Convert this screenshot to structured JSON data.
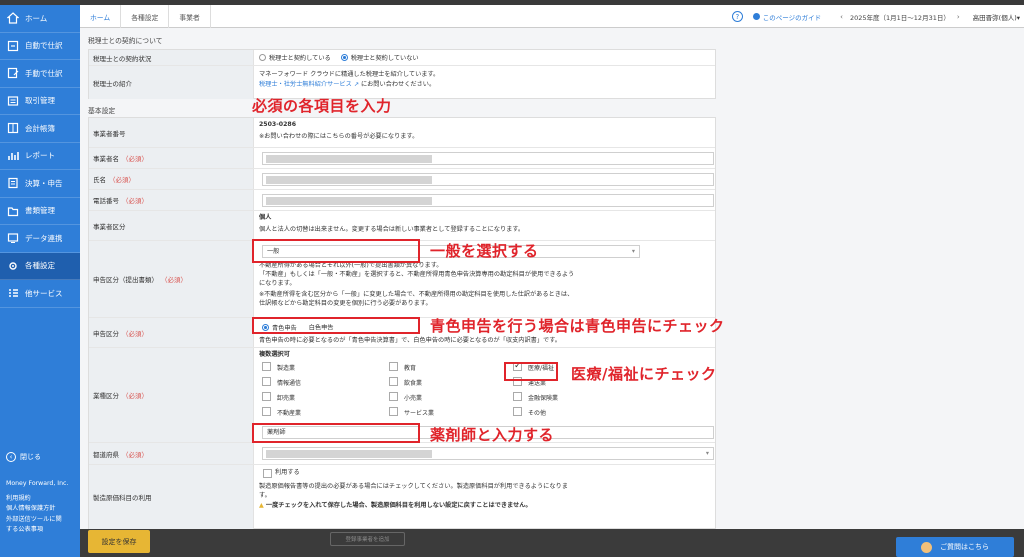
{
  "sidebar": {
    "items": [
      {
        "label": "ホーム",
        "icon": "home-icon"
      },
      {
        "label": "自動で仕訳",
        "icon": "auto-journal-icon"
      },
      {
        "label": "手動で仕訳",
        "icon": "manual-journal-icon"
      },
      {
        "label": "取引管理",
        "icon": "transaction-icon"
      },
      {
        "label": "会計帳簿",
        "icon": "ledger-icon"
      },
      {
        "label": "レポート",
        "icon": "report-icon"
      },
      {
        "label": "決算・申告",
        "icon": "tax-return-icon"
      },
      {
        "label": "書類管理",
        "icon": "folder-icon"
      },
      {
        "label": "データ連携",
        "icon": "data-link-icon"
      },
      {
        "label": "各種設定",
        "icon": "gear-icon"
      },
      {
        "label": "他サービス",
        "icon": "grid-icon"
      }
    ],
    "close_label": "閉じる",
    "company": "Money Forward, Inc.",
    "links": [
      "利用規約",
      "個人情報保護方針",
      "外部送信ツールに関",
      "する公表事項"
    ]
  },
  "header": {
    "breadcrumb": [
      "ホーム",
      "各種設定",
      "事業者"
    ],
    "help": "?",
    "guide_label": "このページのガイド",
    "fiscal_year": "2025年度（1月1日〜12月31日）",
    "business_name": "高田晋弥(個人)▾"
  },
  "tax_accountant": {
    "section_title": "税理士との契約について",
    "contract_label": "税理士との契約状況",
    "contract_opt1": "税理士と契約している",
    "contract_opt2": "税理士と契約していない",
    "intro_label": "税理士の紹介",
    "intro_text": "マネーフォワード クラウドに精通した税理士を紹介しています。",
    "intro_link": "税理士・社労士無料紹介サービス",
    "intro_suffix": "にお問い合わせください。"
  },
  "basic": {
    "section_title": "基本設定",
    "id_label": "事業者番号",
    "id_value": "2503-0286",
    "id_note": "※お問い合わせの際にはこちらの番号が必要になります。",
    "required": "（必須）",
    "name_label": "事業者名",
    "person_label": "氏名",
    "phone_label": "電話番号",
    "type_label": "事業者区分",
    "type_value": "個人",
    "type_note": "個人と法人の切替は出来ません。変更する場合は新しい事業者として登録することになります。",
    "filing_label": "申告区分（提出書類）",
    "filing_value": "一般",
    "filing_note1": "不動産所得がある場合とそれ以外(一般)で提出書類が異なります。",
    "filing_note2": "「不動産」もしくは「一般・不動産」を選択すると、不動産所得用青色申告決算専用の勘定科目が使用できるよう",
    "filing_note3": "になります。",
    "filing_note4": "※不動産所得を含む区分から「一般」に変更した場合で、不動産所得用の勘定科目を使用した仕訳があるときは、",
    "filing_note5": "仕訳帳などから勘定科目の変更を個別に行う必要があります。",
    "return_label": "申告区分",
    "return_opt1": "青色申告",
    "return_opt2": "白色申告",
    "return_note": "青色申告の時に必要となるのが「青色申告決算書」で、白色申告の時に必要となるのが「収支内訳書」です。",
    "industry_label": "業種区分",
    "industry_multi": "複数選択可",
    "industries": [
      "製造業",
      "教育",
      "医療/福祉",
      "情報通信",
      "飲食業",
      "運送業",
      "卸売業",
      "小売業",
      "金融保険業",
      "不動産業",
      "サービス業",
      "その他"
    ],
    "industry_other_value": "薬剤師",
    "pref_label": "都道府県",
    "mfg_label": "製造原価科目の利用",
    "mfg_opt": "利用する",
    "mfg_note1": "製造原価報告書等の提出の必要がある場合にはチェックしてください。製造原価科目が利用できるようになりま",
    "mfg_note2": "す。",
    "mfg_warn": "一度チェックを入れて保存した場合、製造原価科目を利用しない設定に戻すことはできません。"
  },
  "annotations": {
    "required_items": "必須の各項目を入力",
    "select_general": "一般を選択する",
    "blue_return": "青色申告を行う場合は青色申告にチェック",
    "medical": "医療/福祉にチェック",
    "pharmacist": "薬剤師と入力する"
  },
  "footer": {
    "save_label": "設定を保存",
    "ghost_label": "登録事業者を追加",
    "qa_label": "ご質問はこちら"
  },
  "colors": {
    "accent": "#2f7ed8",
    "annotation": "#e0242b",
    "save": "#e7b634"
  }
}
